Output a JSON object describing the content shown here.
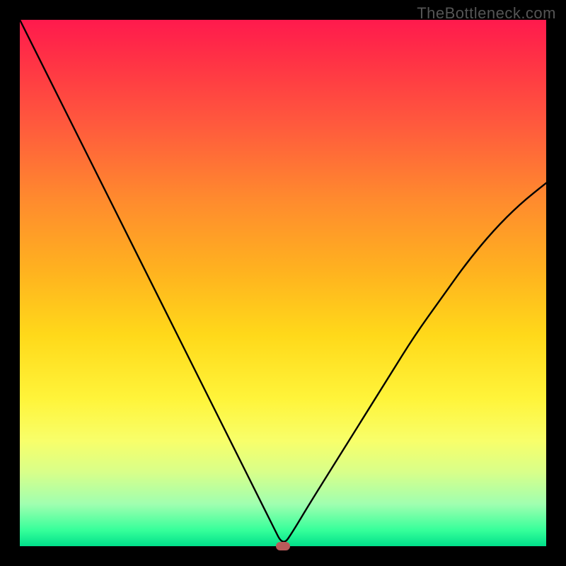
{
  "watermark": "TheBottleneck.com",
  "chart_data": {
    "type": "line",
    "title": "",
    "xlabel": "",
    "ylabel": "",
    "xlim": [
      0,
      100
    ],
    "ylim": [
      0,
      100
    ],
    "grid": false,
    "legend": false,
    "gradient_direction": "vertical",
    "gradient_stops": [
      {
        "pos": 0.0,
        "color": "#ff1a4d"
      },
      {
        "pos": 0.5,
        "color": "#ffd91a"
      },
      {
        "pos": 0.97,
        "color": "#35ff9a"
      },
      {
        "pos": 1.0,
        "color": "#00e08a"
      }
    ],
    "series": [
      {
        "name": "curve",
        "x": [
          0,
          5,
          10,
          15,
          20,
          25,
          30,
          35,
          40,
          45,
          48,
          50,
          52,
          55,
          60,
          65,
          70,
          75,
          80,
          85,
          90,
          95,
          100
        ],
        "y": [
          100,
          90,
          80,
          70,
          60,
          50,
          40,
          30,
          20,
          10,
          4,
          0,
          3,
          8,
          16,
          24,
          32,
          40,
          47,
          54,
          60,
          65,
          69
        ]
      }
    ],
    "marker": {
      "x": 50,
      "y": 0,
      "color": "#b85a5a",
      "shape": "rounded-rect"
    }
  }
}
